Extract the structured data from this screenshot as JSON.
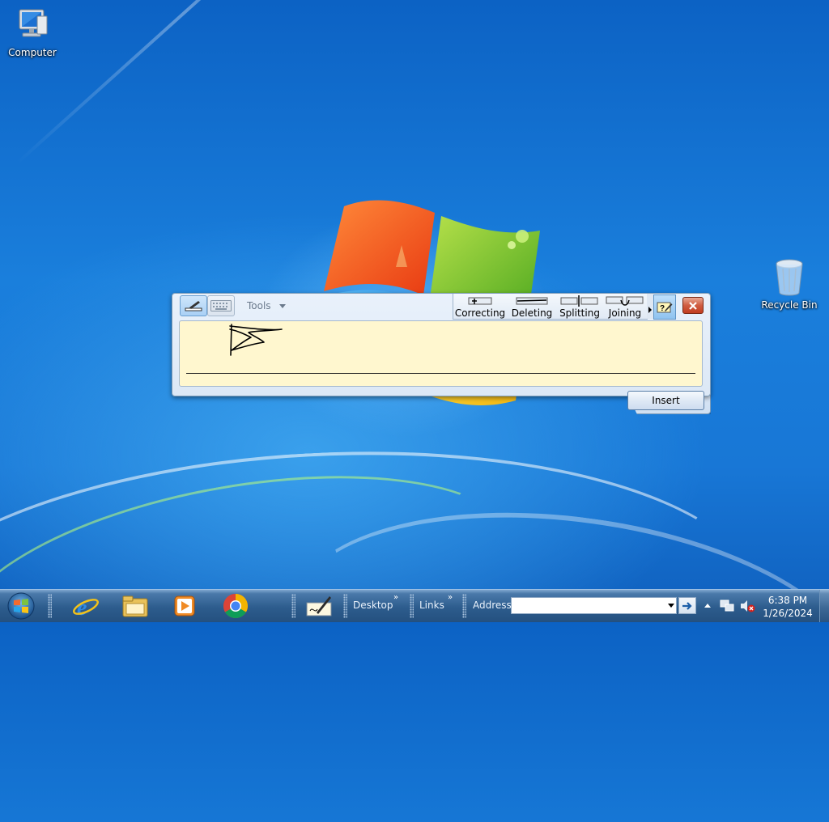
{
  "desktop": {
    "icons": [
      {
        "label": "Computer",
        "icon": "computer-icon"
      },
      {
        "label": "Recycle Bin",
        "icon": "recycle-bin-icon"
      }
    ]
  },
  "input_panel": {
    "mode_buttons": [
      {
        "name": "writing-pad",
        "icon": "pen-pad-icon",
        "active": true
      },
      {
        "name": "touch-keyboard",
        "icon": "keyboard-icon",
        "active": false
      }
    ],
    "tools_label": "Tools",
    "gestures": [
      {
        "label": "Correcting",
        "icon": "correcting-gesture-icon"
      },
      {
        "label": "Deleting",
        "icon": "deleting-gesture-icon"
      },
      {
        "label": "Splitting",
        "icon": "splitting-gesture-icon"
      },
      {
        "label": "Joining",
        "icon": "joining-gesture-icon"
      }
    ],
    "insert_label": "Insert",
    "pad_color": "#fff7cf"
  },
  "taskbar": {
    "pinned": [
      "start-orb-icon",
      "internet-explorer-icon",
      "windows-explorer-icon",
      "media-player-icon",
      "chrome-icon",
      "tablet-input-panel-icon"
    ],
    "toolbars": {
      "desktop_label": "Desktop",
      "links_label": "Links",
      "address_label": "Address",
      "chevron": "»",
      "address_value": ""
    },
    "tray_icons": [
      "show-hidden-icons",
      "network-icon",
      "volume-muted-icon"
    ],
    "clock": {
      "time": "6:38 PM",
      "date": "1/26/2024"
    }
  },
  "colors": {
    "desktop_blue": "#1877d6",
    "taskbar": "#2d5c8d",
    "close_red": "#c23d20"
  }
}
